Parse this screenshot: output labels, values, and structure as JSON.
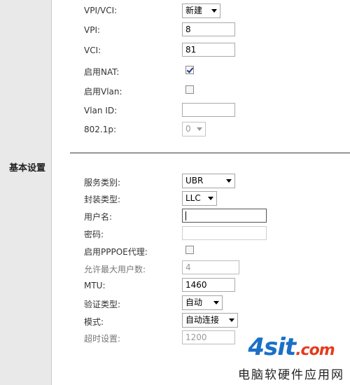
{
  "sidebar": {
    "title": "基本设置"
  },
  "top": {
    "vpivci": {
      "label": "VPI/VCI:",
      "value": "新建"
    },
    "vpi": {
      "label": "VPI:",
      "value": "8"
    },
    "vci": {
      "label": "VCI:",
      "value": "81"
    },
    "enable_nat": {
      "label": "启用NAT:",
      "checked": true
    },
    "enable_vlan": {
      "label": "启用Vlan:",
      "checked": false
    },
    "vlan_id": {
      "label": "Vlan ID:",
      "value": ""
    },
    "dot1p": {
      "label": "802.1p:",
      "value": "0"
    }
  },
  "bottom": {
    "service_type": {
      "label": "服务类别:",
      "value": "UBR"
    },
    "encap_type": {
      "label": "封装类型:",
      "value": "LLC"
    },
    "username": {
      "label": "用户名:",
      "value": ""
    },
    "password": {
      "label": "密码:",
      "value": ""
    },
    "pppoe_proxy": {
      "label": "启用PPPOE代理:",
      "checked": false
    },
    "max_users": {
      "label": "允许最大用户数:",
      "value": "4"
    },
    "mtu": {
      "label": "MTU:",
      "value": "1460"
    },
    "auth_type": {
      "label": "验证类型:",
      "value": "自动"
    },
    "mode": {
      "label": "模式:",
      "value": "自动连接"
    },
    "timeout": {
      "label": "超时设置:",
      "value": "1200"
    }
  },
  "watermark": {
    "logo": "4sit",
    "logo_suffix": ".com",
    "text": "电脑软硬件应用网"
  }
}
